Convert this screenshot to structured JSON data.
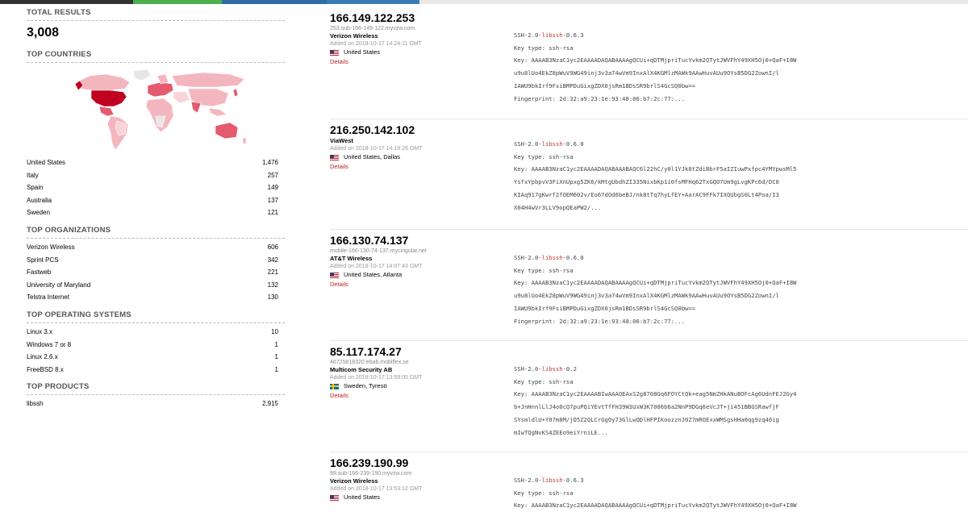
{
  "colors": {
    "accent": "#c0392b",
    "map_dark": "#c0011f",
    "map_mid": "#e45a6e",
    "map_light": "#f4b6be",
    "map_base": "#e6e6e6"
  },
  "topbar_colors": [
    "#333333",
    "#4cae4c",
    "#2e6da4",
    "#3a7db5",
    "#e9e9e9"
  ],
  "summary": {
    "total_results_title": "TOTAL RESULTS",
    "total_results_value": "3,008",
    "top_countries_title": "TOP COUNTRIES",
    "countries": [
      {
        "name": "United States",
        "count": "1,476"
      },
      {
        "name": "Italy",
        "count": "257"
      },
      {
        "name": "Spain",
        "count": "149"
      },
      {
        "name": "Australia",
        "count": "137"
      },
      {
        "name": "Sweden",
        "count": "121"
      }
    ],
    "top_orgs_title": "TOP ORGANIZATIONS",
    "orgs": [
      {
        "name": "Verizon Wireless",
        "count": "606"
      },
      {
        "name": "Sprint PCS",
        "count": "342"
      },
      {
        "name": "Fastweb",
        "count": "221"
      },
      {
        "name": "University of Maryland",
        "count": "132"
      },
      {
        "name": "Telstra Internet",
        "count": "130"
      }
    ],
    "top_os_title": "TOP OPERATING SYSTEMS",
    "os": [
      {
        "name": "Linux 3.x",
        "count": "10"
      },
      {
        "name": "Windows 7 or 8",
        "count": "1"
      },
      {
        "name": "Linux 2.6.x",
        "count": "1"
      },
      {
        "name": "FreeBSD 8.x",
        "count": "1"
      }
    ],
    "top_products_title": "TOP PRODUCTS",
    "products": [
      {
        "name": "libssh",
        "count": "2,915"
      }
    ]
  },
  "results": [
    {
      "ip": "166.149.122.253",
      "hostname": "253.sub-166-149-122.myvzw.com",
      "org": "Verizon Wireless",
      "added": "Added on 2018-10-17 14:24:11 GMT",
      "location": "United States",
      "flag": "us",
      "details": "Details",
      "banner": {
        "pre": "SSH-2.0-",
        "hl": "libssh",
        "post": "-0.6.3",
        "lines": [
          "Key type: ssh-rsa",
          "Key: AAAAB3NzaC1yc2EAAAADAQABAAAAgQCUi+qDTMjpriTucYvkm2QTytJWVFhY49XH5Oj0+QaF+I8W",
          "u9u8lUo4EkZ8pWuV9WG49inj3v3a74wVm9InxAlX4KGMlzMAWk9AAwHuvAUu9OYsB5DG2ZownI/l",
          "IAWU9bkIrf9FsiBMPDuGixgZDX0jsRm1BDsSR9brlS4GcSQ0bw==",
          "Fingerprint: 2d:32:a9:23:1e:93:48:06:b7:2c:77:..."
        ]
      }
    },
    {
      "ip": "216.250.142.102",
      "hostname": "",
      "org": "ViaWest",
      "added": "Added on 2018-10-17 14:19:26 GMT",
      "location": "United States,   Dallas",
      "flag": "us",
      "details": "Details",
      "banner": {
        "pre": "SSH-2.0-",
        "hl": "libssh",
        "post": "-0.6.0",
        "lines": [
          "Key type: ssh-rsa",
          "Key: AAAAB3NzaC1yc2EAAAADAQABAAABAQC6l22hC/y0l1YJk8tZdiBbrF5aIZIuwPxfpc4YMYpwsMl5",
          "YsfxYpbpvV3FiXnUpxg5ZK6/kMtgUbdhZI335NixbKp1i0fsMFHq62TxGQO7Um9gLvgKPc6d/DC0",
          "KIAq917gKwrf2fOEM602v/Eo67dOd6beBJ/nk8tTq7hyLfEY+AarAC9FFk7IXQUbgS0Lt4Poa/I3",
          "X04H4wVr3LLV9opQEaPW2/..."
        ]
      }
    },
    {
      "ip": "166.130.74.137",
      "hostname": "mobile-166-130-74-137.mycingular.net",
      "org": "AT&T Wireless",
      "added": "Added on 2018-10-17 14:07:43 GMT",
      "location": "United States,   Atlanta",
      "flag": "us",
      "details": "Details",
      "banner": {
        "pre": "SSH-2.0-",
        "hl": "libssh",
        "post": "-0.6.0",
        "lines": [
          "Key type: ssh-rsa",
          "Key: AAAAB3NzaC1yc2EAAAADAQABAAAAgQCUi+qDTMjpriTucYvkm2QTytJWVFhY49XH5Oj0+QaF+I8W",
          "u9u8lUo4EkZ8pWuV9WG49inj3v3a74wVm9InxAlX4KGMlzMAWk9AAwHuvAUu9OYsB5DG2ZownI/l",
          "IAWU9bkIrf9FsiBMPDuGixgZDX0jsRm1BDsSR9brlS4GcSQ0bw==",
          "Fingerprint: 2d:32:a9:23:1e:93:48:06:b7:2c:77:..."
        ]
      }
    },
    {
      "ip": "85.117.174.27",
      "hostname": "46725818320.ebab.mobiflex.se",
      "org": "Multicom Security AB",
      "added": "Added on 2018-10-17 13:59:05 GMT",
      "location": "Sweden,   Tyresö",
      "flag": "se",
      "details": "Details",
      "banner": {
        "pre": "SSH-2.0-",
        "hl": "libssh",
        "post": "-0.2",
        "lines": [
          "Key type: ssh-rsa",
          "Key: AAAAB3NzaC1yc2EAAAABIwAAAQEAxS2g8708Gq6FOYCtQk+eag5NmZHkANuBOFcAg6UdnFEJ2Gy4",
          "b+JnHnnlLlJ4o0cQ7puPQiYEvtTfFH39W3UxW3K7006b6a2NnP9DGq6eVcJT+ji451BBGSRawfjF",
          "SYsmldlU+Y07m8M/jD5Z2QLCrGgOy73GlLwQDlHFPIKoozznJ0Z7mROExxWMSgsHHa0qg9zq40ig",
          "mIwTQgNvKS4ZEEo9eiYrniLE..."
        ]
      }
    },
    {
      "ip": "166.239.190.99",
      "hostname": "99.sub-166-239-190.myvzw.com",
      "org": "Verizon Wireless",
      "added": "Added on 2018-10-17 13:53:12 GMT",
      "location": "United States",
      "flag": "us",
      "details": "",
      "banner": {
        "pre": "SSH-2.0-",
        "hl": "libssh",
        "post": "-0.6.3",
        "lines": [
          "Key type: ssh-rsa",
          "Key: AAAAB3NzaC1yc2EAAAADAQABAAAAgQCUi+qDTMjpriTucYvkm2QTytJWVFhY49XH5Oj0+QaF+I8W"
        ]
      }
    }
  ]
}
